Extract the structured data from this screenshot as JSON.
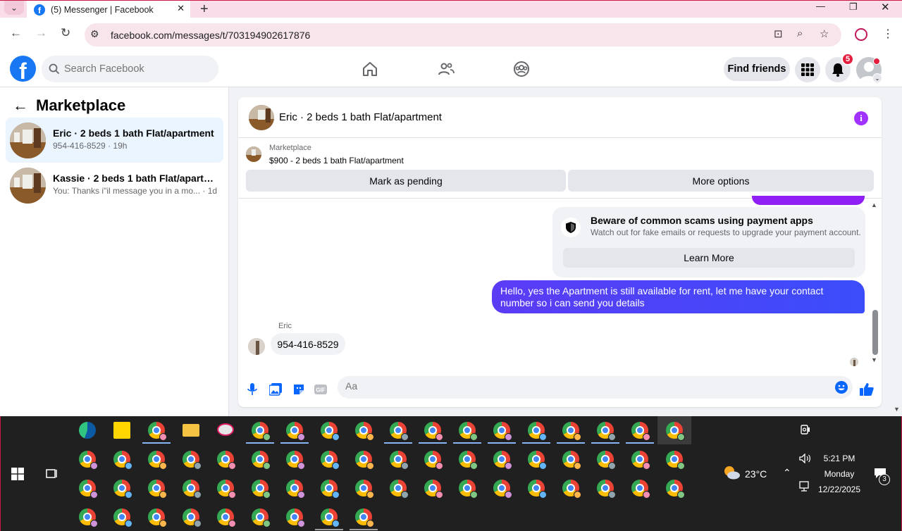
{
  "browser": {
    "tab_title": "(5) Messenger | Facebook",
    "url": "facebook.com/messages/t/703194902617876"
  },
  "fb": {
    "search_placeholder": "Search Facebook",
    "find_friends": "Find friends",
    "notification_count": "5"
  },
  "left_panel": {
    "title": "Marketplace",
    "conversations": [
      {
        "name": "Eric · 2 beds 1 bath Flat/apartment",
        "sub": "954-416-8529 · 19h",
        "active": true
      },
      {
        "name": "Kassie · 2 beds 1 bath Flat/apartm...",
        "sub": "You: Thanks i\"il message you in a mo...  · 1d",
        "active": false
      }
    ]
  },
  "chat": {
    "header_title": "Eric · 2 beds 1 bath Flat/apartment",
    "marketplace_label": "Marketplace",
    "listing": "$900 - 2 beds 1 bath Flat/apartment",
    "mark_pending": "Mark as pending",
    "more_options": "More options",
    "scam_title": "Beware of common scams using payment apps",
    "scam_sub": "Watch out for fake emails or requests to upgrade your payment account.",
    "learn_more": "Learn More",
    "outgoing_message": "Hello, yes the Apartment is still available for rent, let me have your contact number so i can send you details",
    "sender": "Eric",
    "incoming_message": "954-416-8529",
    "composer_placeholder": "Aa"
  },
  "taskbar": {
    "weather": "23°C",
    "time": "5:21 PM",
    "day": "Monday",
    "date": "12/22/2025",
    "notif_count": "3"
  },
  "colors": {
    "fb_blue": "#1877f2",
    "messenger_purple": "#5b3cf5",
    "badge_red": "#e41e3f",
    "browser_pink": "#f9dde8"
  }
}
